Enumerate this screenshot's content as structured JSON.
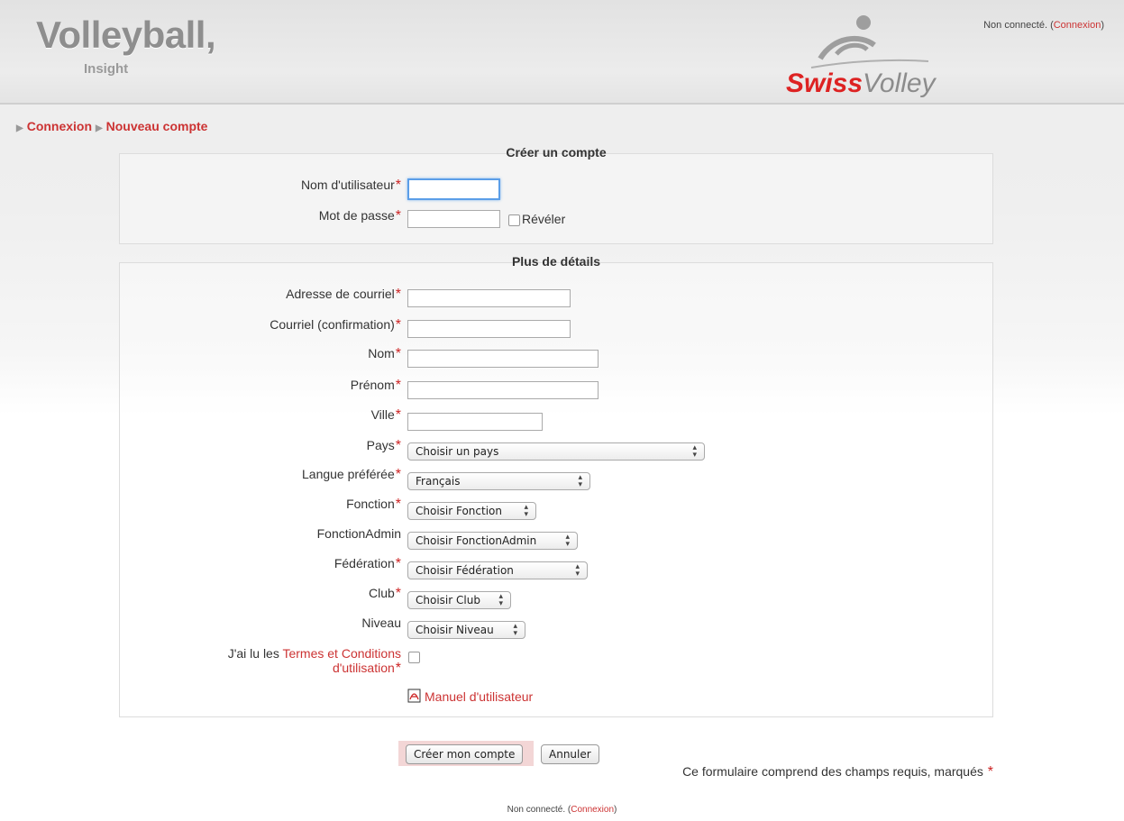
{
  "header": {
    "site_name": "Volleyball,",
    "site_sub": "Insight",
    "login_status": "Non connecté. (",
    "login_link": "Connexion",
    "login_close": ")",
    "logo_text_a": "Swiss",
    "logo_text_b": "Volley"
  },
  "breadcrumb": {
    "item1": "Connexion",
    "item2": "Nouveau compte"
  },
  "section1": {
    "legend": "Créer un compte",
    "username_label": "Nom d'utilisateur",
    "password_label": "Mot de passe",
    "reveal_label": "Révéler"
  },
  "section2": {
    "legend": "Plus de détails",
    "email_label": "Adresse de courriel",
    "email_confirm_label": "Courriel (confirmation)",
    "lastname_label": "Nom",
    "firstname_label": "Prénom",
    "city_label": "Ville",
    "country_label": "Pays",
    "country_value": "Choisir un pays",
    "language_label": "Langue préférée",
    "language_value": "Français",
    "function_label": "Fonction",
    "function_value": "Choisir Fonction",
    "functionadmin_label": "FonctionAdmin",
    "functionadmin_value": "Choisir FonctionAdmin",
    "federation_label": "Fédération",
    "federation_value": "Choisir Fédération",
    "club_label": "Club",
    "club_value": "Choisir Club",
    "level_label": "Niveau",
    "level_value": "Choisir Niveau",
    "terms_prefix": "J'ai lu les ",
    "terms_link1": "Termes et Conditions",
    "terms_link2": "d'utilisation",
    "manual_link": "Manuel d'utilisateur"
  },
  "required_mark": "*",
  "buttons": {
    "create": "Créer mon compte",
    "cancel": "Annuler"
  },
  "required_note": "Ce formulaire comprend des champs requis, marqués",
  "footer": {
    "status": "Non connecté. (",
    "link": "Connexion",
    "close": ")"
  },
  "colors": {
    "accent": "#cc3333",
    "focus": "#5b9ee8"
  }
}
